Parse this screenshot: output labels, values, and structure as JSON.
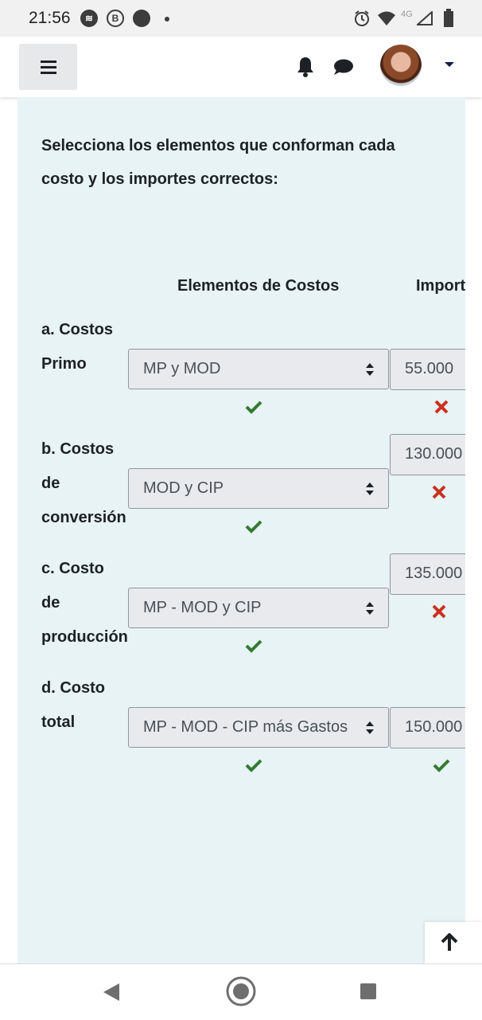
{
  "status_bar": {
    "time": "21:56",
    "network": "4G",
    "icons": [
      "spotify-icon",
      "b-icon",
      "circle-icon",
      "dot-icon",
      "alarm-icon",
      "wifi-icon",
      "signal-icon",
      "battery-icon"
    ]
  },
  "navbar": {
    "icons": [
      "hamburger-menu-icon",
      "bell-icon",
      "chat-icon",
      "avatar",
      "caret-down-icon"
    ]
  },
  "question": {
    "text": "Selecciona los elementos que conforman cada costo y los importes correctos:",
    "columns": [
      "Elementos de Costos",
      "Import"
    ],
    "rows": [
      {
        "label_lines": [
          "a. Costos",
          "Primo"
        ],
        "element": "MP y MOD",
        "element_correct": true,
        "amount": "55.000",
        "amount_correct": false
      },
      {
        "label_lines": [
          "b. Costos",
          "de",
          "conversión"
        ],
        "element": "MOD y CIP",
        "element_correct": true,
        "amount": "130.000",
        "amount_correct": false
      },
      {
        "label_lines": [
          "c. Costo",
          "de",
          "producción"
        ],
        "element": "MP - MOD y CIP",
        "element_correct": true,
        "amount": "135.000",
        "amount_correct": false
      },
      {
        "label_lines": [
          "d. Costo",
          "total"
        ],
        "element": "MP - MOD - CIP más Gastos",
        "element_correct": true,
        "amount": "150.000",
        "amount_correct": true
      }
    ]
  },
  "colors": {
    "card_bg": "#e7f3f5",
    "correct": "#357a32",
    "incorrect": "#ca3120"
  },
  "icons": {
    "back_to_top": "arrow-up-icon",
    "system_nav": [
      "back-icon",
      "home-icon",
      "recents-icon"
    ]
  }
}
